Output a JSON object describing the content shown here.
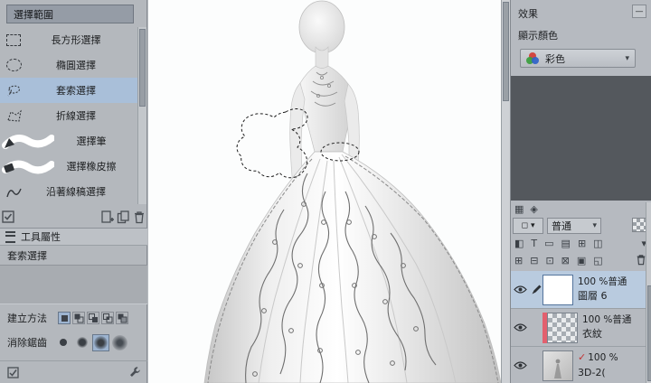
{
  "left_panel": {
    "group_title": "選擇範圍",
    "tools": [
      {
        "label": "長方形選擇"
      },
      {
        "label": "橢圓選擇"
      },
      {
        "label": "套索選擇"
      },
      {
        "label": "折線選擇"
      },
      {
        "label": "選擇筆"
      },
      {
        "label": "選擇橡皮擦"
      },
      {
        "label": "沿著線稿選擇"
      }
    ]
  },
  "tool_property_panel": {
    "title": "工具屬性",
    "tool_name": "套索選擇",
    "create_method_label": "建立方法",
    "antialias_label": "消除鋸齒"
  },
  "right_panel": {
    "effects_label": "效果",
    "minimize_glyph": "—",
    "display_color_label": "顯示顏色",
    "color_dropdown_value": "彩色",
    "layer_panel": {
      "blend_mode": "普通",
      "layers": [
        {
          "info": "100 %普通",
          "name": "圖層 6",
          "selected": true
        },
        {
          "info": "100 %普通",
          "name": "衣紋",
          "selected": false
        },
        {
          "info": "100 %",
          "name": "3D-2(",
          "selected": false
        }
      ]
    }
  },
  "icons": {
    "dropdown_arrow": "▾",
    "grid_tab": "▦",
    "layers_tab": "◈",
    "blend_square": "◻",
    "prop_icons": [
      "◧",
      "T",
      "▭",
      "▤",
      "⊞",
      "◫"
    ],
    "action_icons": [
      "⊞",
      "⊟",
      "⊡",
      "⊠",
      "▣",
      "◱"
    ],
    "check_mark": "✓"
  },
  "colors": {
    "selection_highlight": "#a9bfd9",
    "layer_selected": "#b9cbdf",
    "marker_red": "#e2606e",
    "dark_panel": "#54585d"
  }
}
